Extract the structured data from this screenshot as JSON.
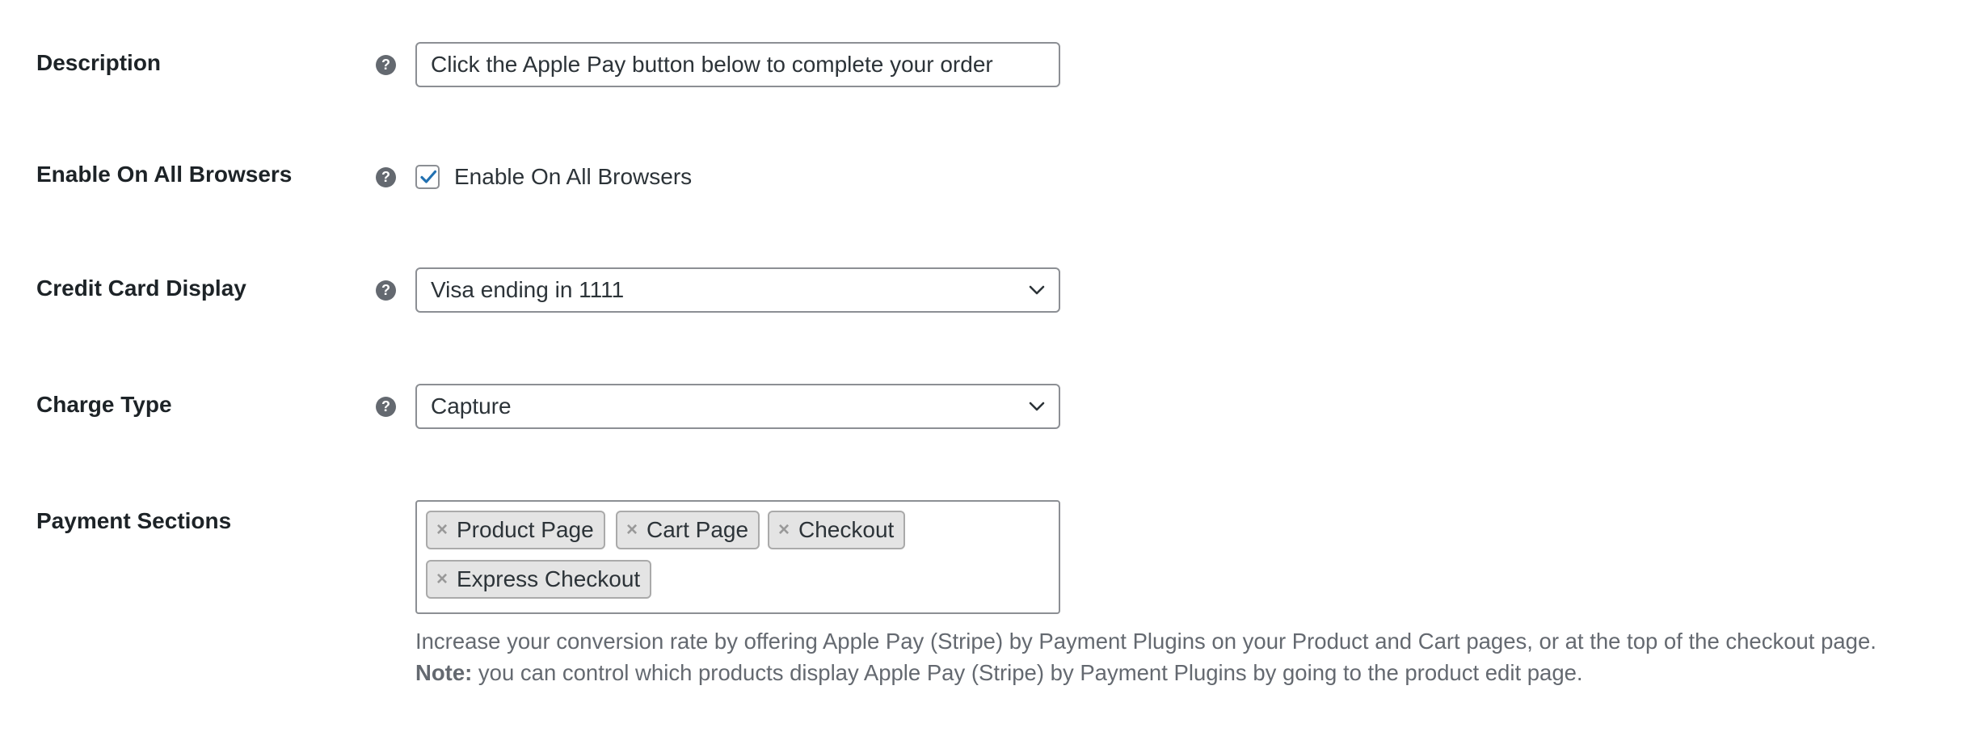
{
  "fields": {
    "description": {
      "label": "Description",
      "value": "Click the Apple Pay button below to complete your order"
    },
    "enable_all_browsers": {
      "label": "Enable On All Browsers",
      "checkbox_label": "Enable On All Browsers",
      "checked": true
    },
    "credit_card_display": {
      "label": "Credit Card Display",
      "selected": "Visa ending in 1111"
    },
    "charge_type": {
      "label": "Charge Type",
      "selected": "Capture"
    },
    "payment_sections": {
      "label": "Payment Sections",
      "tags": [
        "Product Page",
        "Cart Page",
        "Checkout",
        "Express Checkout"
      ],
      "remove_glyph": "×",
      "help_text": "Increase your conversion rate by offering Apple Pay (Stripe) by Payment Plugins on your Product and Cart pages, or at the top of the checkout page.",
      "note_label": "Note:",
      "note_text": " you can control which products display Apple Pay (Stripe) by Payment Plugins by going to the product edit page."
    }
  },
  "help_icon_glyph": "?",
  "icons": {
    "help": "question-circle-icon",
    "chevron": "chevron-down-icon",
    "check": "checkmark-icon",
    "remove": "remove-tag-icon"
  },
  "colors": {
    "checkbox_check": "#2271b1",
    "help_icon": "#646970",
    "tag_background": "#e4e4e4"
  }
}
